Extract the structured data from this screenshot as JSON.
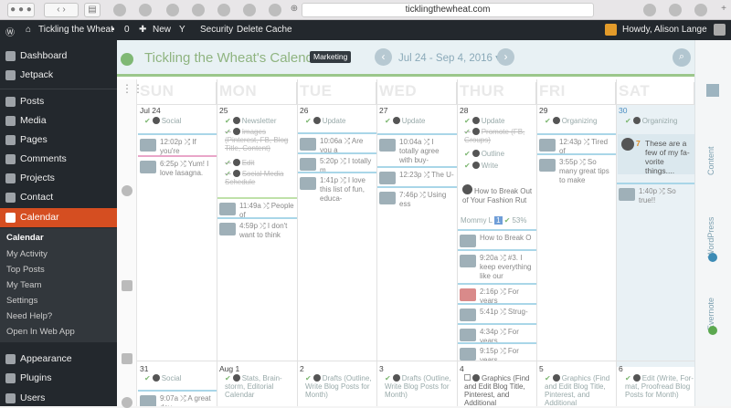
{
  "browser": {
    "url": "ticklingthewheat.com"
  },
  "adminbar": {
    "site": "Tickling the Wheat",
    "comments_count": "0",
    "new_label": "New",
    "security": "Security",
    "delete_cache": "Delete Cache",
    "howdy": "Howdy, Alison Lange"
  },
  "sidebar": {
    "items": [
      "Dashboard",
      "Jetpack",
      "Posts",
      "Media",
      "Pages",
      "Comments",
      "Projects",
      "Contact",
      "Calendar"
    ],
    "submenu": [
      "Calendar",
      "My Activity",
      "Top Posts",
      "My Team",
      "Settings",
      "Need Help?",
      "Open In Web App"
    ],
    "bottom": [
      "Appearance",
      "Plugins",
      "Users"
    ],
    "accent": "#d54e21"
  },
  "calendar": {
    "title": "Tickling the Wheat's Calendar",
    "badge": "Marketing",
    "range": "Jul 24 - Sep 4, 2016",
    "days": [
      "SUN",
      "MON",
      "TUE",
      "WED",
      "THUR",
      "FRI",
      "SAT"
    ],
    "right_tabs": [
      "Content",
      "WordPress",
      "Evernote"
    ],
    "week1": {
      "dates": [
        "Jul 24",
        "25",
        "26",
        "27",
        "28",
        "29",
        "30"
      ],
      "sun": {
        "tasks": [
          "Social"
        ],
        "posts": [
          "12:02p ⤮ If you're",
          "6:25p ⤮ Yum! I love lasagna."
        ]
      },
      "mon": {
        "tasks": [
          "Newsletter",
          "Images (Pinterest, FB, Blog Title, Content)",
          "Edit",
          "Social Media Schedule"
        ],
        "posts": [
          "11:49a ⤮ People of",
          "4:59p ⤮ I don't want to think"
        ]
      },
      "tue": {
        "tasks": [
          "Update"
        ],
        "posts": [
          "10:06a ⤮ Are you a",
          "5:20p ⤮ I totally m",
          "1:41p ⤮ I love this list of fun, educa-"
        ]
      },
      "wed": {
        "tasks": [
          "Update"
        ],
        "posts": [
          "10:04a ⤮ I totally agree with buy-",
          "12:23p ⤮ The U-",
          "7:46p ⤮ Using ess"
        ]
      },
      "thur": {
        "tasks": [
          "Update",
          "Promote (FB, Groups)",
          "Outline",
          "Write"
        ],
        "task_card": "How to Break Out of Your Fashion Rut",
        "task_meta": "Mommy L",
        "task_pct": "53%",
        "posts": [
          "How to Break O",
          "9:20a ⤮ #3. I keep everything like our",
          "2:16p ⤮ For years",
          "5:41p ⤮ Strug-",
          "4:34p ⤮ For years",
          "9:15p ⤮ For years"
        ]
      },
      "fri": {
        "tasks": [
          "Organizing"
        ],
        "posts": [
          "12:43p ⤮ Tired of",
          "3:55p ⤮ So many great tips to make"
        ]
      },
      "sat": {
        "tasks": [
          "Organizing"
        ],
        "pinned_num": "7",
        "pinned": "These are a few of my fa- vorite things....",
        "posts": [
          "1:40p ⤮ So true!!"
        ]
      }
    },
    "week2": {
      "dates": [
        "31",
        "Aug 1",
        "2",
        "3",
        "4",
        "5",
        "6"
      ],
      "sun": {
        "tasks": [
          "Social"
        ],
        "posts": [
          "9:07a ⤮ A great day"
        ]
      },
      "mon": {
        "tasks": [
          "Stats, Brain- storm, Editorial Calendar"
        ]
      },
      "tue": {
        "tasks": [
          "Drafts (Outline, Write Blog Posts for Month)"
        ]
      },
      "wed": {
        "tasks": [
          "Drafts (Outline, Write Blog Posts for Month)"
        ]
      },
      "thur": {
        "tasks": [
          "Graphics (Find and Edit Blog Title, Pinterest, and Additional"
        ]
      },
      "fri": {
        "tasks": [
          "Graphics (Find and Edit Blog Title, Pinterest, and Additional"
        ]
      },
      "sat": {
        "tasks": [
          "Edit (Write, For- mat, Proofread Blog Posts for Month)"
        ]
      }
    }
  }
}
